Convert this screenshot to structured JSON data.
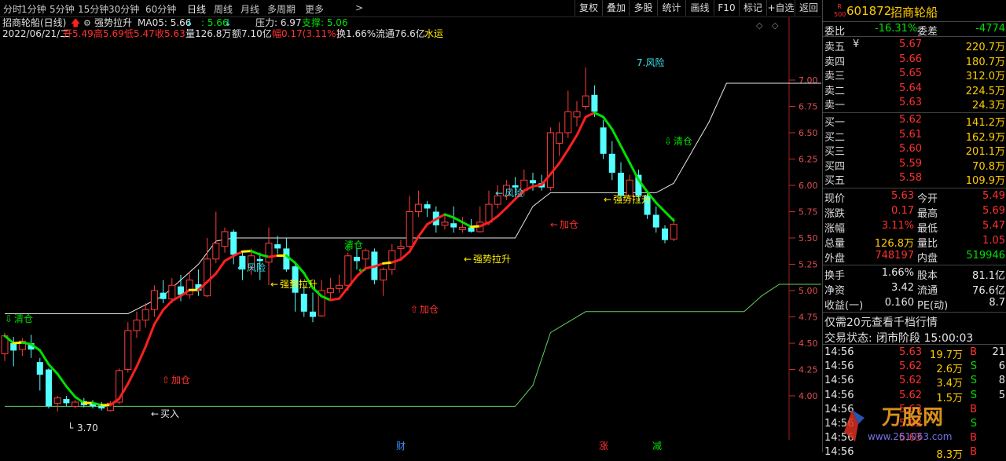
{
  "periods": [
    "分时",
    "1分钟",
    "5分钟",
    "15分钟",
    "30分钟",
    "60分钟",
    "日线",
    "周线",
    "月线",
    "多周期",
    "更多"
  ],
  "active_period": "日线",
  "toolbar": [
    "复权",
    "叠加",
    "多股",
    "统计",
    "画线",
    "F10",
    "标记",
    "+自选",
    "返回"
  ],
  "header": {
    "name_line": "招商轮船(日线)",
    "indicator_name": "强势拉升",
    "ma5_label": "MA05: 5.66",
    "ma5_val2": ": 5.66",
    "pressure": "压力: 6.97",
    "support": "支撑: 5.06",
    "date": "2022/06/21/二",
    "open": "开5.49",
    "high": "高5.69",
    "low": "低5.47",
    "close": "收5.63",
    "volume": "量126.8万",
    "amount": "额7.10亿",
    "amplitude": "幅0.17(3.11%)",
    "turnover": "换1.66%",
    "float": "流通76.6亿",
    "sector": "水运"
  },
  "price_axis": [
    "7.00",
    "6.75",
    "6.50",
    "6.25",
    "6.00",
    "5.75",
    "5.50",
    "5.25",
    "5.00",
    "4.75",
    "4.50",
    "4.25",
    "4.00"
  ],
  "annotations": [
    {
      "text": "清仓",
      "color": "green"
    },
    {
      "text": "加仓",
      "color": "red"
    },
    {
      "text": "买入",
      "color": "white"
    },
    {
      "text": "3.70",
      "color": "white"
    },
    {
      "text": "风险",
      "color": "cyan"
    },
    {
      "text": "强势拉升",
      "color": "yellow"
    },
    {
      "text": "清仓",
      "color": "green"
    },
    {
      "text": "加仓",
      "color": "red"
    },
    {
      "text": "强势拉升",
      "color": "yellow"
    },
    {
      "text": "风险",
      "color": "cyan"
    },
    {
      "text": "加仓",
      "color": "red"
    },
    {
      "text": "强势拉升",
      "color": "yellow"
    },
    {
      "text": "7.风险",
      "color": "cyan"
    },
    {
      "text": "清仓",
      "color": "green"
    }
  ],
  "bottom_markers": [
    {
      "text": "财",
      "color": "#3a8cff"
    },
    {
      "text": "涨",
      "color": "#ff3030"
    },
    {
      "text": "减",
      "color": "#00e000"
    }
  ],
  "chart_data": {
    "type": "candlestick",
    "candles": [
      [
        4.4,
        4.57,
        4.6,
        4.33
      ],
      [
        4.5,
        4.43,
        4.56,
        4.28
      ],
      [
        4.44,
        4.52,
        4.55,
        4.38
      ],
      [
        4.5,
        4.44,
        4.58,
        4.36
      ],
      [
        4.32,
        4.2,
        4.36,
        4.05
      ],
      [
        4.25,
        3.9,
        4.26,
        3.88
      ],
      [
        3.93,
        3.98,
        4.0,
        3.85
      ],
      [
        3.97,
        3.93,
        4.0,
        3.9
      ],
      [
        3.9,
        3.94,
        3.96,
        3.88
      ],
      [
        3.95,
        3.91,
        3.98,
        3.89
      ],
      [
        3.93,
        3.9,
        3.96,
        3.88
      ],
      [
        3.92,
        3.88,
        3.94,
        3.86
      ],
      [
        3.86,
        3.93,
        3.95,
        3.85
      ],
      [
        3.94,
        4.24,
        4.26,
        3.92
      ],
      [
        4.25,
        4.62,
        4.7,
        4.22
      ],
      [
        4.62,
        4.72,
        4.8,
        4.55
      ],
      [
        4.72,
        4.82,
        4.88,
        4.65
      ],
      [
        4.82,
        5.0,
        5.05,
        4.75
      ],
      [
        4.98,
        4.92,
        5.1,
        4.88
      ],
      [
        4.92,
        5.05,
        5.12,
        4.88
      ],
      [
        5.04,
        4.96,
        5.15,
        4.9
      ],
      [
        4.96,
        5.1,
        5.18,
        4.92
      ],
      [
        5.06,
        5.0,
        5.2,
        4.95
      ],
      [
        4.95,
        5.3,
        5.5,
        4.94
      ],
      [
        5.3,
        5.45,
        5.75,
        5.26
      ],
      [
        5.42,
        5.56,
        5.6,
        5.36
      ],
      [
        5.56,
        5.34,
        5.58,
        5.25
      ],
      [
        5.33,
        5.2,
        5.38,
        5.1
      ],
      [
        5.22,
        5.33,
        5.4,
        5.15
      ],
      [
        5.3,
        5.28,
        5.36,
        5.1
      ],
      [
        5.27,
        5.45,
        5.6,
        5.05
      ],
      [
        5.44,
        5.4,
        5.52,
        5.35
      ],
      [
        5.4,
        5.2,
        5.5,
        5.18
      ],
      [
        5.23,
        4.98,
        5.28,
        4.8
      ],
      [
        4.97,
        4.8,
        5.05,
        4.75
      ],
      [
        4.8,
        4.75,
        4.98,
        4.7
      ],
      [
        4.76,
        5.0,
        5.1,
        4.75
      ],
      [
        4.98,
        5.02,
        5.12,
        4.9
      ],
      [
        5.02,
        5.05,
        5.15,
        4.98
      ],
      [
        5.05,
        5.33,
        5.36,
        5.0
      ],
      [
        5.32,
        5.28,
        5.4,
        5.2
      ],
      [
        5.3,
        5.38,
        5.4,
        5.22
      ],
      [
        5.37,
        5.1,
        5.4,
        5.06
      ],
      [
        5.1,
        5.2,
        5.22,
        4.95
      ],
      [
        5.2,
        5.38,
        5.44,
        5.15
      ],
      [
        5.4,
        5.42,
        5.48,
        5.3
      ],
      [
        5.42,
        5.75,
        5.9,
        5.4
      ],
      [
        5.75,
        5.82,
        5.95,
        5.7
      ],
      [
        5.82,
        5.78,
        5.85,
        5.7
      ],
      [
        5.75,
        5.62,
        5.8,
        5.55
      ],
      [
        5.62,
        5.65,
        5.72,
        5.58
      ],
      [
        5.64,
        5.6,
        5.8,
        5.55
      ],
      [
        5.58,
        5.6,
        5.7,
        5.55
      ],
      [
        5.6,
        5.56,
        5.68,
        5.55
      ],
      [
        5.56,
        5.65,
        5.8,
        5.55
      ],
      [
        5.65,
        5.82,
        5.95,
        5.62
      ],
      [
        5.82,
        5.9,
        6.0,
        5.78
      ],
      [
        5.9,
        6.0,
        6.05,
        5.86
      ],
      [
        6.0,
        5.98,
        6.08,
        5.9
      ],
      [
        5.95,
        6.05,
        6.15,
        5.9
      ],
      [
        6.05,
        6.02,
        6.12,
        5.95
      ],
      [
        6.02,
        5.98,
        6.1,
        5.95
      ],
      [
        5.98,
        6.5,
        6.55,
        5.95
      ],
      [
        6.4,
        6.5,
        6.6,
        6.28
      ],
      [
        6.5,
        6.7,
        6.9,
        6.45
      ],
      [
        6.65,
        6.7,
        6.8,
        6.56
      ],
      [
        6.75,
        6.85,
        7.12,
        6.72
      ],
      [
        6.86,
        6.7,
        6.95,
        6.65
      ],
      [
        6.55,
        6.3,
        6.62,
        6.25
      ],
      [
        6.3,
        6.12,
        6.42,
        6.05
      ],
      [
        6.12,
        5.9,
        6.22,
        5.85
      ],
      [
        5.9,
        6.05,
        6.1,
        5.85
      ],
      [
        6.1,
        5.9,
        6.15,
        5.85
      ],
      [
        5.9,
        5.72,
        5.95,
        5.68
      ],
      [
        5.72,
        5.6,
        5.8,
        5.55
      ],
      [
        5.59,
        5.48,
        5.62,
        5.45
      ],
      [
        5.49,
        5.63,
        5.69,
        5.47
      ]
    ],
    "ylim": [
      3.65,
      7.25
    ],
    "support_line": [
      [
        0,
        3.9
      ],
      [
        10,
        3.9
      ],
      [
        20,
        3.9
      ],
      [
        30,
        3.9
      ],
      [
        40,
        3.9
      ],
      [
        50,
        3.9
      ],
      [
        58,
        3.9
      ],
      [
        60,
        4.1
      ],
      [
        62,
        4.6
      ],
      [
        66,
        4.8
      ],
      [
        70,
        4.8
      ],
      [
        76,
        4.8
      ],
      [
        84,
        4.8
      ],
      [
        86,
        4.95
      ],
      [
        88,
        5.06
      ],
      [
        94,
        5.06
      ]
    ],
    "pressure_line": [
      [
        0,
        4.78
      ],
      [
        14,
        4.78
      ],
      [
        18,
        4.95
      ],
      [
        22,
        5.25
      ],
      [
        24,
        5.47
      ],
      [
        26,
        5.5
      ],
      [
        30,
        5.5
      ],
      [
        40,
        5.5
      ],
      [
        44,
        5.5
      ],
      [
        58,
        5.5
      ],
      [
        60,
        5.8
      ],
      [
        62,
        5.93
      ],
      [
        66,
        5.93
      ],
      [
        74,
        5.93
      ],
      [
        76,
        6.02
      ],
      [
        80,
        6.6
      ],
      [
        82,
        6.97
      ],
      [
        94,
        6.97
      ]
    ]
  },
  "quote": {
    "code": "601872",
    "name": "招商轮船",
    "badge_top": "R",
    "badge_bottom": "500",
    "weibi_label": "委比",
    "weibi": "-16.31%",
    "weicha_label": "委差",
    "weicha": "-4774",
    "asks": [
      {
        "label": "卖五",
        "price": "5.67",
        "vol": "220.7万"
      },
      {
        "label": "卖四",
        "price": "5.66",
        "vol": "180.7万"
      },
      {
        "label": "卖三",
        "price": "5.65",
        "vol": "312.0万"
      },
      {
        "label": "卖二",
        "price": "5.64",
        "vol": "224.5万"
      },
      {
        "label": "卖一",
        "price": "5.63",
        "vol": "24.3万"
      }
    ],
    "bids": [
      {
        "label": "买一",
        "price": "5.62",
        "vol": "141.2万"
      },
      {
        "label": "买二",
        "price": "5.61",
        "vol": "162.9万"
      },
      {
        "label": "买三",
        "price": "5.60",
        "vol": "201.1万"
      },
      {
        "label": "买四",
        "price": "5.59",
        "vol": "70.8万"
      },
      {
        "label": "买五",
        "price": "5.58",
        "vol": "109.9万"
      }
    ],
    "stats": [
      {
        "l1": "现价",
        "v1": "5.63",
        "c1": "red",
        "l2": "今开",
        "v2": "5.49",
        "c2": "red"
      },
      {
        "l1": "涨跌",
        "v1": "0.17",
        "c1": "red",
        "l2": "最高",
        "v2": "5.69",
        "c2": "red"
      },
      {
        "l1": "涨幅",
        "v1": "3.11%",
        "c1": "red",
        "l2": "最低",
        "v2": "5.47",
        "c2": "red"
      },
      {
        "l1": "总量",
        "v1": "126.8万",
        "c1": "yellow",
        "l2": "量比",
        "v2": "1.05",
        "c2": "red"
      },
      {
        "l1": "外盘",
        "v1": "748197",
        "c1": "red",
        "l2": "内盘",
        "v2": "519946",
        "c2": "green"
      }
    ],
    "stats2": [
      {
        "l1": "换手",
        "v1": "1.66%",
        "l2": "股本",
        "v2": "81.1亿"
      },
      {
        "l1": "净资",
        "v1": "3.42",
        "l2": "流通",
        "v2": "76.6亿"
      },
      {
        "l1": "收益(一)",
        "v1": "0.160",
        "l2": "PE(动)",
        "v2": "8.7"
      }
    ],
    "promo": "仅需20元查看千档行情",
    "trade_status_label": "交易状态:",
    "trade_status": "闭市阶段 15:00:03",
    "ticks": [
      {
        "time": "14:56",
        "price": "5.63",
        "vol": "19.7万",
        "side": "B",
        "n": "21"
      },
      {
        "time": "14:56",
        "price": "5.62",
        "vol": "2.6万",
        "side": "S",
        "n": "6"
      },
      {
        "time": "14:56",
        "price": "5.62",
        "vol": "3.4万",
        "side": "S",
        "n": "8"
      },
      {
        "time": "14:56",
        "price": "5.62",
        "vol": "1.5万",
        "side": "S",
        "n": "5"
      },
      {
        "time": "14:56",
        "price": "5.63",
        "vol": "",
        "side": "B",
        "n": ""
      },
      {
        "time": "14:56",
        "price": "5.62",
        "vol": "",
        "side": "S",
        "n": ""
      },
      {
        "time": "14:56",
        "price": "5.63",
        "vol": "",
        "side": "B",
        "n": ""
      },
      {
        "time": "14:56",
        "price": "",
        "vol": "8.3万",
        "side": "B",
        "n": ""
      }
    ],
    "watermark_text": "万股网",
    "watermark_url": "www.261063.com"
  }
}
